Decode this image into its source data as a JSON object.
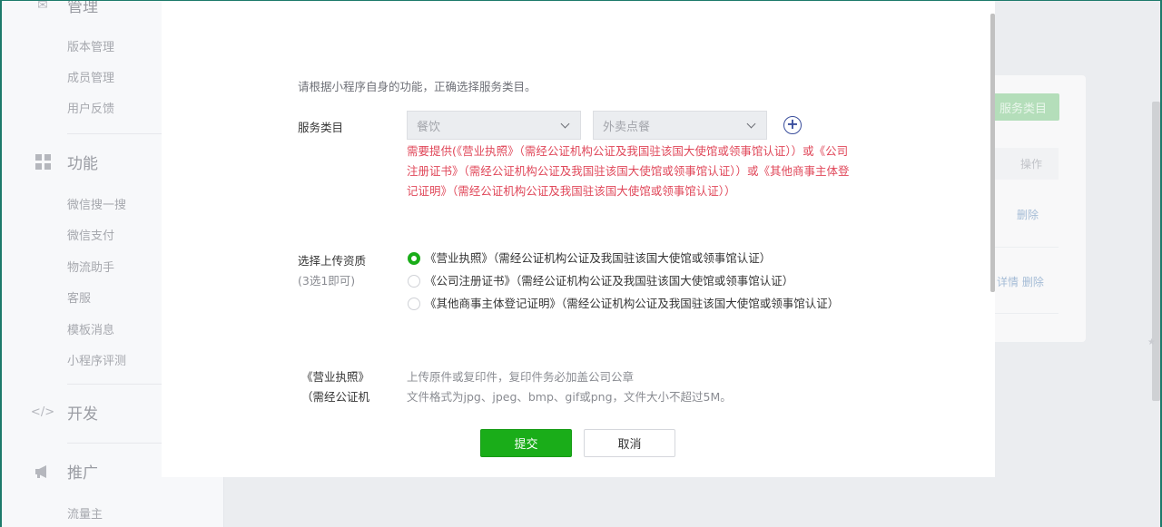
{
  "sidebar": {
    "top_section": "管理",
    "manage_items": [
      "版本管理",
      "成员管理",
      "用户反馈"
    ],
    "function_section": "功能",
    "function_items": [
      "微信搜一搜",
      "微信支付",
      "物流助手",
      "客服",
      "模板消息",
      "小程序评测"
    ],
    "dev_section": "开发",
    "promo_section": "推广",
    "promo_items": [
      "流量主"
    ]
  },
  "background": {
    "add_category_button": "服务类目",
    "table_header_action": "操作",
    "row1_action": "删除",
    "row2_actions": "详情 删除"
  },
  "modal": {
    "intro": "请根据小程序自身的功能，正确选择服务类目。",
    "category_label": "服务类目",
    "primary_select": "餐饮",
    "secondary_select": "外卖点餐",
    "requirement_text": "需要提供(《营业执照》（需经公证机构公证及我国驻该国大使馆或领事馆认证））或《公司注册证书》（需经公证机构公证及我国驻该国大使馆或领事馆认证））或《其他商事主体登记证明》（需经公证机构公证及我国驻该国大使馆或领事馆认证））",
    "qualification_label": "选择上传资质",
    "qualification_sub": "(3选1即可)",
    "options": [
      {
        "label": "《营业执照》（需经公证机构公证及我国驻该国大使馆或领事馆认证）",
        "selected": true
      },
      {
        "label": "《公司注册证书》（需经公证机构公证及我国驻该国大使馆或领事馆认证）",
        "selected": false
      },
      {
        "label": "《其他商事主体登记证明》（需经公证机构公证及我国驻该国大使馆或领事馆认证）",
        "selected": false
      }
    ],
    "upload_label_line1": "《营业执照》",
    "upload_label_line2": "（需经公证机",
    "upload_hint_1": "上传原件或复印件，复印件务必加盖公司公章",
    "upload_hint_2": "文件格式为jpg、jpeg、bmp、gif或png，文件大小不超过5M。",
    "submit_label": "提交",
    "cancel_label": "取消"
  },
  "colors": {
    "primary_green": "#1aad19",
    "warning_red": "#e0485a",
    "link_blue": "#3a4e9c"
  }
}
